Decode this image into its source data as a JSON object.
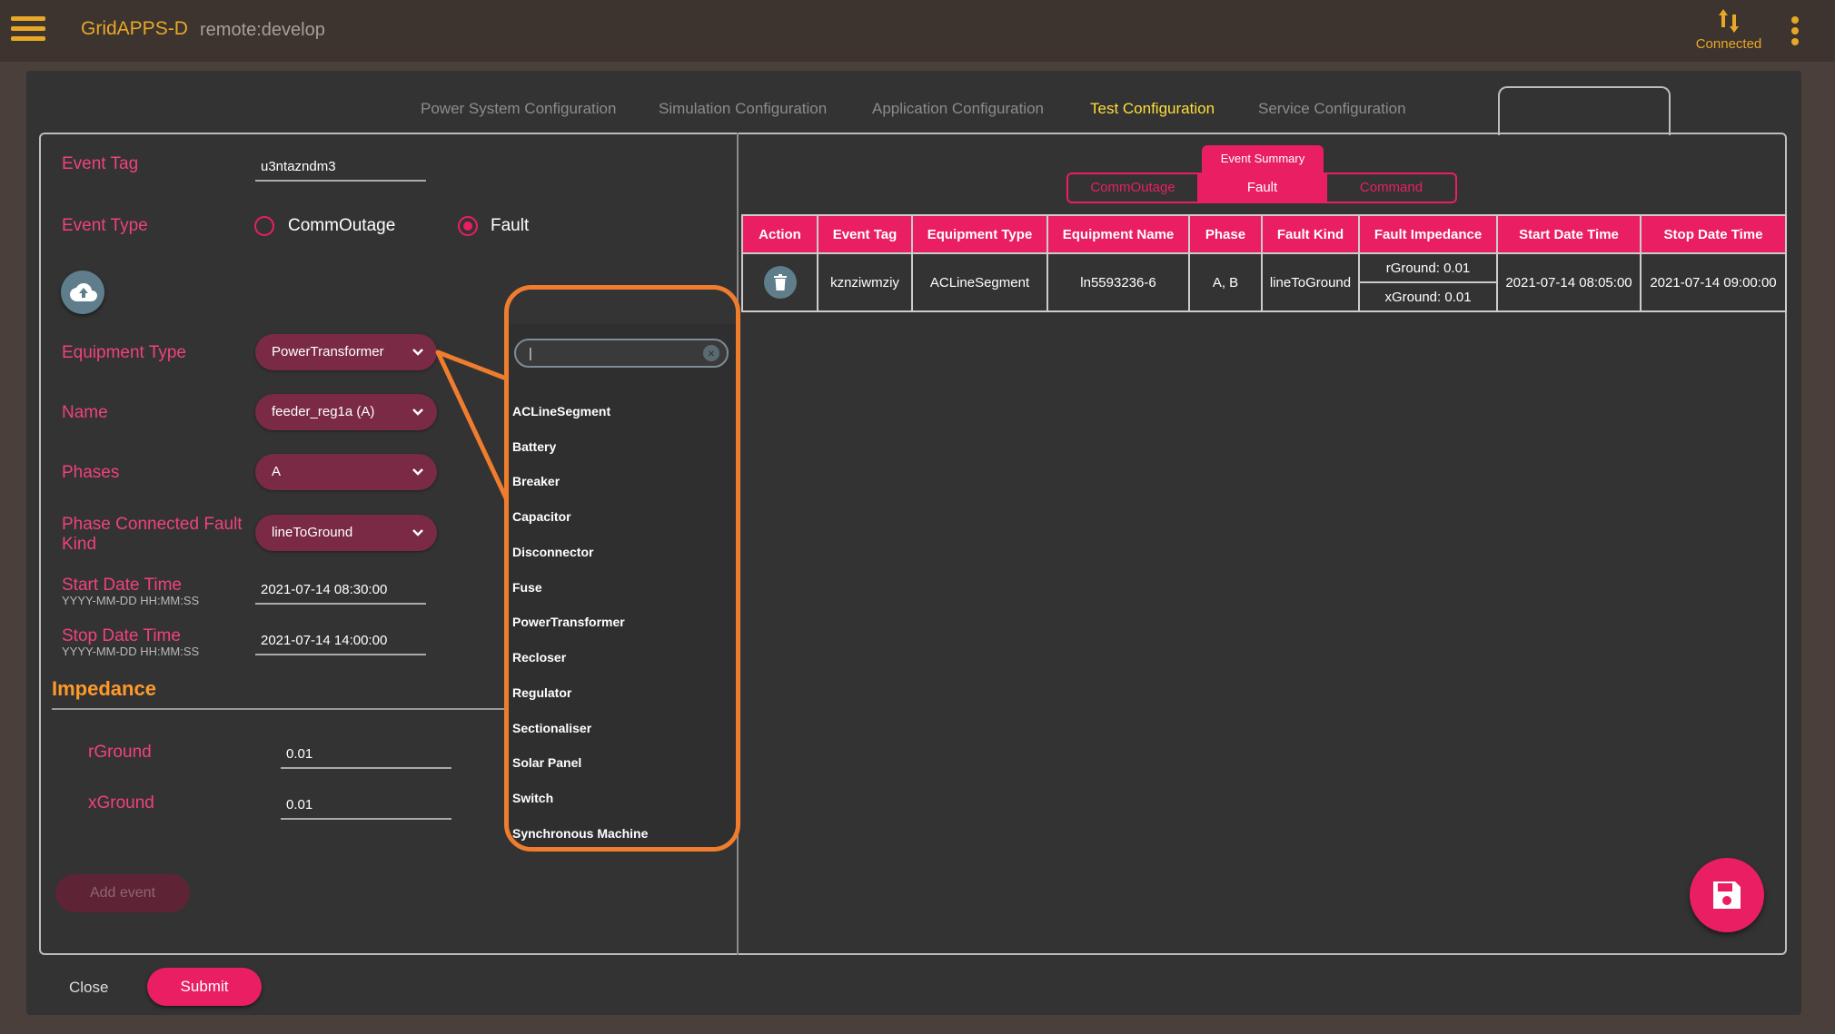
{
  "header": {
    "brand": "GridAPPS-D",
    "branch": "remote:develop",
    "status": "Connected"
  },
  "tabs": [
    {
      "label": "Power System Configuration"
    },
    {
      "label": "Simulation Configuration"
    },
    {
      "label": "Application Configuration"
    },
    {
      "label": "Test Configuration"
    },
    {
      "label": "Service Configuration"
    }
  ],
  "form": {
    "event_tag_label": "Event Tag",
    "event_tag_value": "u3ntazndm3",
    "event_type_label": "Event Type",
    "event_type_options": [
      "CommOutage",
      "Fault"
    ],
    "equipment_type_label": "Equipment Type",
    "equipment_type_value": "PowerTransformer",
    "name_label": "Name",
    "name_value": "feeder_reg1a (A)",
    "phases_label": "Phases",
    "phases_value": "A",
    "fault_kind_label_1": "Phase Connected Fault",
    "fault_kind_label_2": "Kind",
    "fault_kind_value": "lineToGround",
    "start_label": "Start Date Time",
    "start_hint": "YYYY-MM-DD HH:MM:SS",
    "start_value": "2021-07-14 08:30:00",
    "stop_label": "Stop Date Time",
    "stop_hint": "YYYY-MM-DD HH:MM:SS",
    "stop_value": "2021-07-14 14:00:00",
    "impedance_title": "Impedance",
    "rground_label": "rGround",
    "rground_value": "0.01",
    "xground_label": "xGround",
    "xground_value": "0.01",
    "add_event": "Add event"
  },
  "footer": {
    "close": "Close",
    "submit": "Submit"
  },
  "summary": {
    "title": "Event Summary",
    "segments": [
      "CommOutage",
      "Fault",
      "Command"
    ],
    "columns": [
      "Action",
      "Event Tag",
      "Equipment Type",
      "Equipment Name",
      "Phase",
      "Fault Kind",
      "Fault Impedance",
      "Start Date Time",
      "Stop Date Time"
    ],
    "row": {
      "event_tag": "kznziwmziy",
      "equipment_type": "ACLineSegment",
      "equipment_name": "ln5593236-6",
      "phase": "A, B",
      "fault_kind": "lineToGround",
      "impedance_r": "rGround: 0.01",
      "impedance_x": "xGround: 0.01",
      "start": "2021-07-14 08:05:00",
      "stop": "2021-07-14 09:00:00"
    }
  },
  "dropdown": {
    "search_value": "|",
    "clear_glyph": "×",
    "items": [
      "ACLineSegment",
      "Battery",
      "Breaker",
      "Capacitor",
      "Disconnector",
      "Fuse",
      "PowerTransformer",
      "Recloser",
      "Regulator",
      "Sectionaliser",
      "Solar Panel",
      "Switch",
      "Synchronous Machine"
    ]
  },
  "colors": {
    "accent": "#e91e63",
    "brand": "#e8a826",
    "highlight": "#f07d2e",
    "active_tab": "#ffde3a"
  }
}
